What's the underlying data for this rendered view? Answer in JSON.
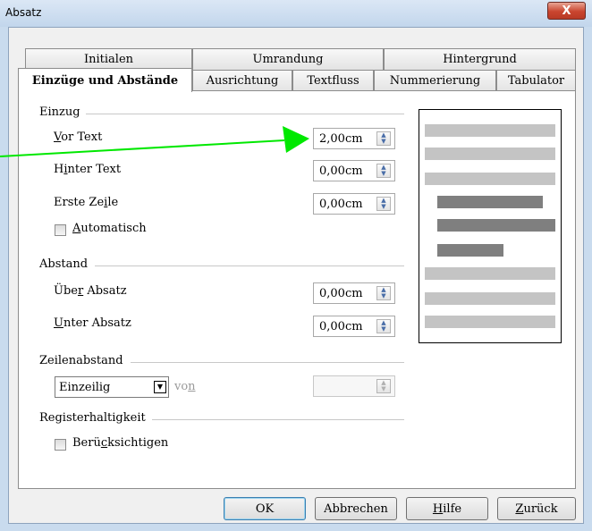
{
  "window": {
    "title": "Absatz",
    "close_label": "X"
  },
  "tabs_row1": [
    "Initialen",
    "Umrandung",
    "Hintergrund"
  ],
  "tabs_row2": [
    "Einzüge und Abstände",
    "Ausrichtung",
    "Textfluss",
    "Nummerierung",
    "Tabulator"
  ],
  "active_tab": "Einzüge und Abstände",
  "einzug": {
    "section_label": "Einzug",
    "vor_text": {
      "label_u": "V",
      "label_rest": "or Text",
      "value": "2,00cm"
    },
    "hinter_text": {
      "label_a": "H",
      "label_u": "i",
      "label_b": "nter Text",
      "value": "0,00cm"
    },
    "erste_zeile": {
      "label_a": "Erste Ze",
      "label_u": "i",
      "label_b": "le",
      "value": "0,00cm"
    },
    "automatisch": {
      "label_u": "A",
      "label_rest": "utomatisch",
      "checked": false
    }
  },
  "abstand": {
    "section_label": "Abstand",
    "ueber_absatz": {
      "label_a": "Übe",
      "label_u": "r",
      "label_b": " Absatz",
      "value": "0,00cm"
    },
    "unter_absatz": {
      "label_u": "U",
      "label_rest": "nter Absatz",
      "value": "0,00cm"
    }
  },
  "zeilenabstand": {
    "section_label": "Zeilenabstand",
    "selected": "Einzeilig",
    "von_a": "vo",
    "von_u": "n",
    "value": ""
  },
  "registerhaltigkeit": {
    "section_label": "Registerhaltigkeit",
    "checkbox_a": "Berü",
    "checkbox_u": "c",
    "checkbox_b": "ksichtigen",
    "checked": false
  },
  "buttons": {
    "ok": "OK",
    "abbrechen": "Abbrechen",
    "hilfe_u": "H",
    "hilfe_rest": "ilfe",
    "zurueck_u": "Z",
    "zurueck_rest": "urück"
  },
  "colors": {
    "annotation_arrow": "#00e800",
    "preview_light": "#c4c4c4",
    "preview_dark": "#7f7f7f",
    "close_button": "#c9452f"
  }
}
